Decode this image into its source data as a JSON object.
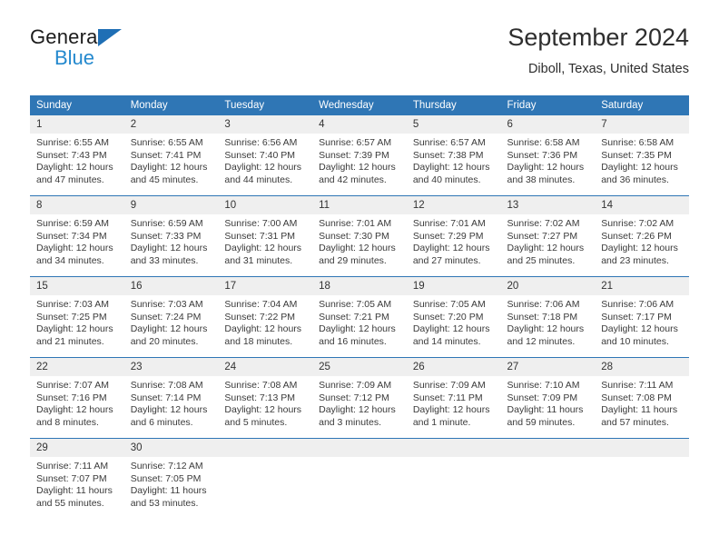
{
  "brand": {
    "name_top": "General",
    "name_bottom": "Blue",
    "triangle_color": "#1f6fb5",
    "blue_color": "#2489ce"
  },
  "header": {
    "title": "September 2024",
    "location": "Diboll, Texas, United States"
  },
  "theme": {
    "header_blue": "#2f76b5",
    "daynum_gray": "#efefef",
    "text": "#3a3a3a"
  },
  "weekdays": [
    "Sunday",
    "Monday",
    "Tuesday",
    "Wednesday",
    "Thursday",
    "Friday",
    "Saturday"
  ],
  "weeks": [
    [
      {
        "day": "1",
        "sunrise": "Sunrise: 6:55 AM",
        "sunset": "Sunset: 7:43 PM",
        "daylight": "Daylight: 12 hours and 47 minutes."
      },
      {
        "day": "2",
        "sunrise": "Sunrise: 6:55 AM",
        "sunset": "Sunset: 7:41 PM",
        "daylight": "Daylight: 12 hours and 45 minutes."
      },
      {
        "day": "3",
        "sunrise": "Sunrise: 6:56 AM",
        "sunset": "Sunset: 7:40 PM",
        "daylight": "Daylight: 12 hours and 44 minutes."
      },
      {
        "day": "4",
        "sunrise": "Sunrise: 6:57 AM",
        "sunset": "Sunset: 7:39 PM",
        "daylight": "Daylight: 12 hours and 42 minutes."
      },
      {
        "day": "5",
        "sunrise": "Sunrise: 6:57 AM",
        "sunset": "Sunset: 7:38 PM",
        "daylight": "Daylight: 12 hours and 40 minutes."
      },
      {
        "day": "6",
        "sunrise": "Sunrise: 6:58 AM",
        "sunset": "Sunset: 7:36 PM",
        "daylight": "Daylight: 12 hours and 38 minutes."
      },
      {
        "day": "7",
        "sunrise": "Sunrise: 6:58 AM",
        "sunset": "Sunset: 7:35 PM",
        "daylight": "Daylight: 12 hours and 36 minutes."
      }
    ],
    [
      {
        "day": "8",
        "sunrise": "Sunrise: 6:59 AM",
        "sunset": "Sunset: 7:34 PM",
        "daylight": "Daylight: 12 hours and 34 minutes."
      },
      {
        "day": "9",
        "sunrise": "Sunrise: 6:59 AM",
        "sunset": "Sunset: 7:33 PM",
        "daylight": "Daylight: 12 hours and 33 minutes."
      },
      {
        "day": "10",
        "sunrise": "Sunrise: 7:00 AM",
        "sunset": "Sunset: 7:31 PM",
        "daylight": "Daylight: 12 hours and 31 minutes."
      },
      {
        "day": "11",
        "sunrise": "Sunrise: 7:01 AM",
        "sunset": "Sunset: 7:30 PM",
        "daylight": "Daylight: 12 hours and 29 minutes."
      },
      {
        "day": "12",
        "sunrise": "Sunrise: 7:01 AM",
        "sunset": "Sunset: 7:29 PM",
        "daylight": "Daylight: 12 hours and 27 minutes."
      },
      {
        "day": "13",
        "sunrise": "Sunrise: 7:02 AM",
        "sunset": "Sunset: 7:27 PM",
        "daylight": "Daylight: 12 hours and 25 minutes."
      },
      {
        "day": "14",
        "sunrise": "Sunrise: 7:02 AM",
        "sunset": "Sunset: 7:26 PM",
        "daylight": "Daylight: 12 hours and 23 minutes."
      }
    ],
    [
      {
        "day": "15",
        "sunrise": "Sunrise: 7:03 AM",
        "sunset": "Sunset: 7:25 PM",
        "daylight": "Daylight: 12 hours and 21 minutes."
      },
      {
        "day": "16",
        "sunrise": "Sunrise: 7:03 AM",
        "sunset": "Sunset: 7:24 PM",
        "daylight": "Daylight: 12 hours and 20 minutes."
      },
      {
        "day": "17",
        "sunrise": "Sunrise: 7:04 AM",
        "sunset": "Sunset: 7:22 PM",
        "daylight": "Daylight: 12 hours and 18 minutes."
      },
      {
        "day": "18",
        "sunrise": "Sunrise: 7:05 AM",
        "sunset": "Sunset: 7:21 PM",
        "daylight": "Daylight: 12 hours and 16 minutes."
      },
      {
        "day": "19",
        "sunrise": "Sunrise: 7:05 AM",
        "sunset": "Sunset: 7:20 PM",
        "daylight": "Daylight: 12 hours and 14 minutes."
      },
      {
        "day": "20",
        "sunrise": "Sunrise: 7:06 AM",
        "sunset": "Sunset: 7:18 PM",
        "daylight": "Daylight: 12 hours and 12 minutes."
      },
      {
        "day": "21",
        "sunrise": "Sunrise: 7:06 AM",
        "sunset": "Sunset: 7:17 PM",
        "daylight": "Daylight: 12 hours and 10 minutes."
      }
    ],
    [
      {
        "day": "22",
        "sunrise": "Sunrise: 7:07 AM",
        "sunset": "Sunset: 7:16 PM",
        "daylight": "Daylight: 12 hours and 8 minutes."
      },
      {
        "day": "23",
        "sunrise": "Sunrise: 7:08 AM",
        "sunset": "Sunset: 7:14 PM",
        "daylight": "Daylight: 12 hours and 6 minutes."
      },
      {
        "day": "24",
        "sunrise": "Sunrise: 7:08 AM",
        "sunset": "Sunset: 7:13 PM",
        "daylight": "Daylight: 12 hours and 5 minutes."
      },
      {
        "day": "25",
        "sunrise": "Sunrise: 7:09 AM",
        "sunset": "Sunset: 7:12 PM",
        "daylight": "Daylight: 12 hours and 3 minutes."
      },
      {
        "day": "26",
        "sunrise": "Sunrise: 7:09 AM",
        "sunset": "Sunset: 7:11 PM",
        "daylight": "Daylight: 12 hours and 1 minute."
      },
      {
        "day": "27",
        "sunrise": "Sunrise: 7:10 AM",
        "sunset": "Sunset: 7:09 PM",
        "daylight": "Daylight: 11 hours and 59 minutes."
      },
      {
        "day": "28",
        "sunrise": "Sunrise: 7:11 AM",
        "sunset": "Sunset: 7:08 PM",
        "daylight": "Daylight: 11 hours and 57 minutes."
      }
    ],
    [
      {
        "day": "29",
        "sunrise": "Sunrise: 7:11 AM",
        "sunset": "Sunset: 7:07 PM",
        "daylight": "Daylight: 11 hours and 55 minutes."
      },
      {
        "day": "30",
        "sunrise": "Sunrise: 7:12 AM",
        "sunset": "Sunset: 7:05 PM",
        "daylight": "Daylight: 11 hours and 53 minutes."
      },
      {
        "day": "",
        "sunrise": "",
        "sunset": "",
        "daylight": ""
      },
      {
        "day": "",
        "sunrise": "",
        "sunset": "",
        "daylight": ""
      },
      {
        "day": "",
        "sunrise": "",
        "sunset": "",
        "daylight": ""
      },
      {
        "day": "",
        "sunrise": "",
        "sunset": "",
        "daylight": ""
      },
      {
        "day": "",
        "sunrise": "",
        "sunset": "",
        "daylight": ""
      }
    ]
  ]
}
